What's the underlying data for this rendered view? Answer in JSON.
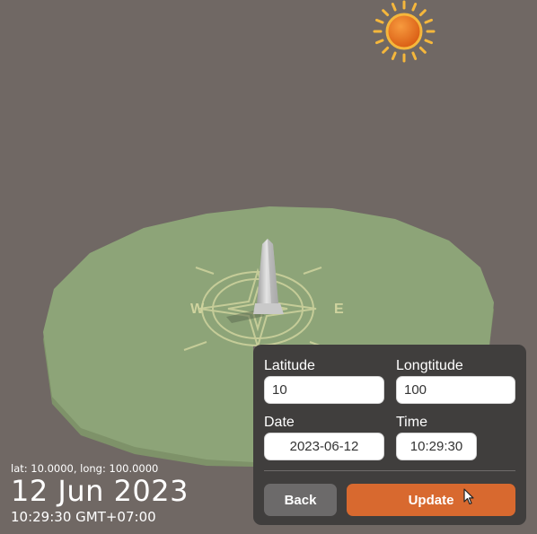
{
  "location_readout": "lat: 10.0000, long: 100.0000",
  "date_display": "12 Jun 2023",
  "time_display": "10:29:30 GMT+07:00",
  "compass": {
    "west": "W",
    "east": "E"
  },
  "form": {
    "latitude_label": "Latitude",
    "latitude_value": "10",
    "longitude_label": "Longtitude",
    "longitude_value": "100",
    "date_label": "Date",
    "date_value": "2023-06-12",
    "time_label": "Time",
    "time_value": "10:29:30",
    "back_label": "Back",
    "update_label": "Update"
  },
  "colors": {
    "background": "#706864",
    "ground": "#8da478",
    "sun": "#e8761f",
    "sun_rays": "#f5b73c",
    "panel": "#403e3d",
    "update_button": "#d8692f",
    "back_button": "#6c6a6a"
  }
}
